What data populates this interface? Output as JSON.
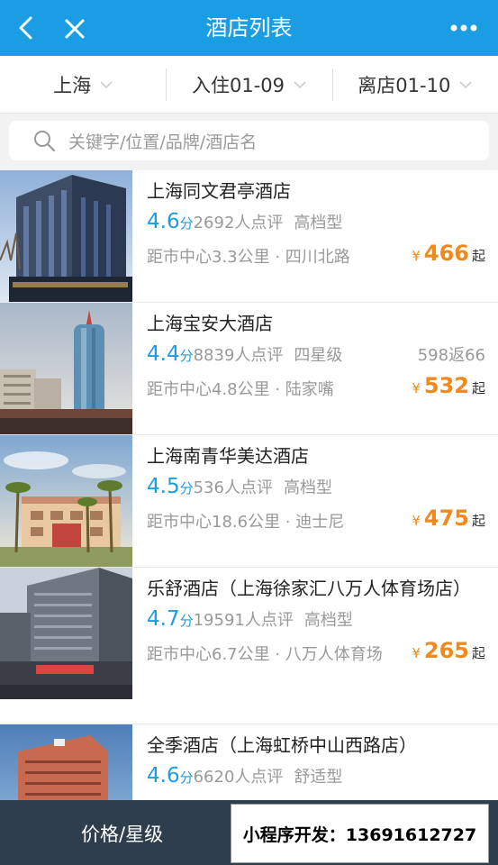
{
  "nav": {
    "title": "酒店列表",
    "back_icon": "chevron-left-icon",
    "close_icon": "close-icon",
    "more_icon": "more-dots-icon"
  },
  "filters": {
    "city": "上海",
    "checkin": "入住01-09",
    "checkout": "离店01-10"
  },
  "search": {
    "placeholder": "关键字/位置/品牌/酒店名"
  },
  "hotels": [
    {
      "name": "上海同文君亭酒店",
      "score": "4.6",
      "score_unit": "分",
      "reviews": "2692人点评",
      "grade": "高档型",
      "promo": "",
      "location": "距市中心3.3公里 · 四川北路",
      "currency": "¥",
      "price": "466",
      "price_suffix": "起"
    },
    {
      "name": "上海宝安大酒店",
      "score": "4.4",
      "score_unit": "分",
      "reviews": "8839人点评",
      "grade": "四星级",
      "promo": "598返66",
      "location": "距市中心4.8公里 · 陆家嘴",
      "currency": "¥",
      "price": "532",
      "price_suffix": "起"
    },
    {
      "name": "上海南青华美达酒店",
      "score": "4.5",
      "score_unit": "分",
      "reviews": "536人点评",
      "grade": "高档型",
      "promo": "",
      "location": "距市中心18.6公里 · 迪士尼",
      "currency": "¥",
      "price": "475",
      "price_suffix": "起"
    },
    {
      "name": "乐舒酒店（上海徐家汇八万人体育场店）",
      "score": "4.7",
      "score_unit": "分",
      "reviews": "19591人点评",
      "grade": "高档型",
      "promo": "",
      "location": "距市中心6.7公里 · 八万人体育场",
      "currency": "¥",
      "price": "265",
      "price_suffix": "起"
    },
    {
      "name": "全季酒店（上海虹桥中山西路店）",
      "score": "4.6",
      "score_unit": "分",
      "reviews": "6620人点评",
      "grade": "舒适型",
      "promo": "",
      "location": "",
      "currency": "",
      "price": "",
      "price_suffix": ""
    }
  ],
  "bottom": {
    "sort_label": "价格/星级"
  },
  "ad": {
    "text": "小程序开发：13691612727"
  },
  "colors": {
    "primary": "#1a9de2",
    "price": "#f08a1c",
    "bottom_bar": "#2f3e4c"
  }
}
